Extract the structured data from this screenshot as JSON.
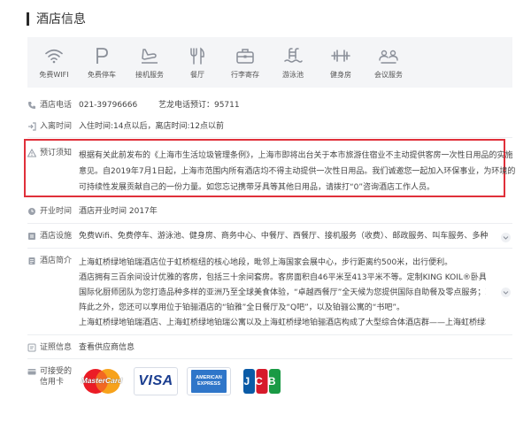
{
  "section_title": "酒店信息",
  "facilities": [
    {
      "icon": "wifi-icon",
      "label": "免费WIFI"
    },
    {
      "icon": "parking-icon",
      "label": "免费停车"
    },
    {
      "icon": "airport-shuttle-icon",
      "label": "接机服务"
    },
    {
      "icon": "restaurant-icon",
      "label": "餐厅"
    },
    {
      "icon": "luggage-icon",
      "label": "行李寄存"
    },
    {
      "icon": "swimming-pool-icon",
      "label": "游泳池"
    },
    {
      "icon": "gym-icon",
      "label": "健身房"
    },
    {
      "icon": "meeting-icon",
      "label": "会议服务"
    }
  ],
  "phone": {
    "label": "酒店电话",
    "value": "021-39796666",
    "extra": "艺龙电话预订：95711"
  },
  "checkin": {
    "label": "入离时间",
    "value": "入住时间:14点以后，离店时间:12点以前"
  },
  "notice": {
    "label": "预订须知",
    "lines": [
      "根据有关此前发布的《上海市生活垃圾管理条例》，上海市即将出台关于本市旅游住宿业不主动提供客房一次性日用品的实施",
      "意见。自2019年7月1日起，上海市范围内所有酒店均不得主动提供一次性日用品。我们诚邀您一起加入环保事业，为环境的",
      "可持续性发展贡献自己的一份力量。如您忘记携带牙具等其他日用品，请拨打“0”咨询酒店工作人员。"
    ]
  },
  "opening": {
    "label": "开业时间",
    "value": "酒店开业时间 2017年"
  },
  "amenities": {
    "label": "酒店设施",
    "value": "免费Wifi、免费停车、游泳池、健身房、商务中心、中餐厅、西餐厅、接机服务（收费）、邮政服务、叫车服务、多种语言..."
  },
  "intro": {
    "label": "酒店简介",
    "lines": [
      "上海虹桥绿地铂瑞酒店位于虹桥枢纽的核心地段，毗邻上海国家会展中心，步行距离约500米，出行便利。",
      "酒店拥有三百余间设计优雅的客房，包括三十余间套房。客房面积自46平米至413平米不等。定制KING KOIL®卧具带给您...",
      "国际化厨师团队为您打造品种多样的亚洲乃至全球美食体验，“卓越西餐厅”全天候为您提供国际自助餐及零点服务；现代化...",
      "阵此之外，您还可以享用位于铂骊酒店的“铂雅”全日餐厅及“Q吧”，以及铂骊公寓的“书吧”。",
      "上海虹桥绿地铂瑞酒店、上海虹桥绿地铂瑞公寓以及上海虹桥绿地铂骊酒店构成了大型综合体酒店群——上海虹桥绿地世界..."
    ]
  },
  "certificate": {
    "label": "证照信息",
    "link": "查看供应商信息"
  },
  "cards": {
    "label_line1": "可接受的",
    "label_line2": "信用卡",
    "mastercard": "MasterCard",
    "visa": "VISA",
    "amex_line1": "AMERICAN",
    "amex_line2": "EXPRESS",
    "jcb": "JCB"
  },
  "colors": {
    "highlight_border": "#e0303a",
    "link": "#2d73c8",
    "facility_bg": "#f4f5f7"
  }
}
